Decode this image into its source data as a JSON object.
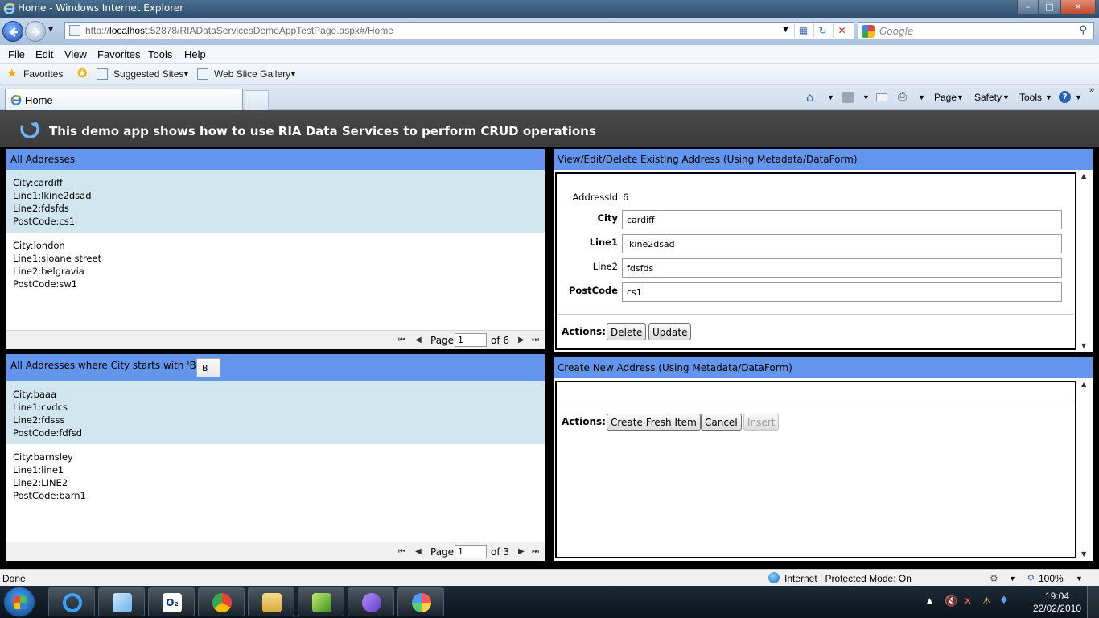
{
  "window": {
    "title": "Home - Windows Internet Explorer"
  },
  "address_bar": {
    "url_prefix": "http://",
    "url_host": "localhost",
    "url_rest": ":52878/RIADataServicesDemoAppTestPage.aspx#/Home",
    "search_placeholder": "Google"
  },
  "menu": [
    "File",
    "Edit",
    "View",
    "Favorites",
    "Tools",
    "Help"
  ],
  "favorites_bar": {
    "favorites_label": "Favorites",
    "suggested_sites": "Suggested Sites",
    "web_slice_gallery": "Web Slice Gallery"
  },
  "tab": {
    "label": "Home"
  },
  "command_bar": {
    "page": "Page",
    "safety": "Safety",
    "tools": "Tools"
  },
  "app": {
    "heading": "This demo app shows how to use RIA Data Services to perform CRUD operations",
    "all_addresses": {
      "title": "All Addresses",
      "records": [
        {
          "city": "City:cardiff",
          "line1": "Line1:lkine2dsad",
          "line2": "Line2:fdsfds",
          "postcode": "PostCode:cs1"
        },
        {
          "city": "City:london",
          "line1": "Line1:sloane street",
          "line2": "Line2:belgravia",
          "postcode": "PostCode:sw1"
        }
      ],
      "pager": {
        "page_label": "Page",
        "page_value": "1",
        "of_label": "of 6"
      }
    },
    "filtered_addresses": {
      "title": "All Addresses where City starts with 'B'",
      "filter_value": "B",
      "records": [
        {
          "city": "City:baaa",
          "line1": "Line1:cvdcs",
          "line2": "Line2:fdsss",
          "postcode": "PostCode:fdfsd"
        },
        {
          "city": "City:barnsley",
          "line1": "Line1:line1",
          "line2": "Line2:LINE2",
          "postcode": "PostCode:barn1"
        }
      ],
      "pager": {
        "page_label": "Page",
        "page_value": "1",
        "of_label": "of 3"
      }
    },
    "edit_form": {
      "title": "View/Edit/Delete Existing Address (Using Metadata/DataForm)",
      "address_id_label": "AddressId",
      "address_id_value": "6",
      "city_label": "City",
      "city_value": "cardiff",
      "line1_label": "Line1",
      "line1_value": "lkine2dsad",
      "line2_label": "Line2",
      "line2_value": "fdsfds",
      "postcode_label": "PostCode",
      "postcode_value": "cs1",
      "actions_label": "Actions:",
      "delete_label": "Delete",
      "update_label": "Update"
    },
    "create_form": {
      "title": "Create New Address (Using Metadata/DataForm)",
      "actions_label": "Actions:",
      "create_label": "Create Fresh Item",
      "cancel_label": "Cancel",
      "insert_label": "Insert"
    }
  },
  "status_bar": {
    "status": "Done",
    "zone": "Internet | Protected Mode: On",
    "zoom": "100%"
  },
  "taskbar": {
    "time": "19:04",
    "date": "22/02/2010"
  },
  "colors": {
    "panel_header": "#6495ed",
    "selected_row": "#d2e6f0",
    "app_header": "#3f3f3f"
  }
}
